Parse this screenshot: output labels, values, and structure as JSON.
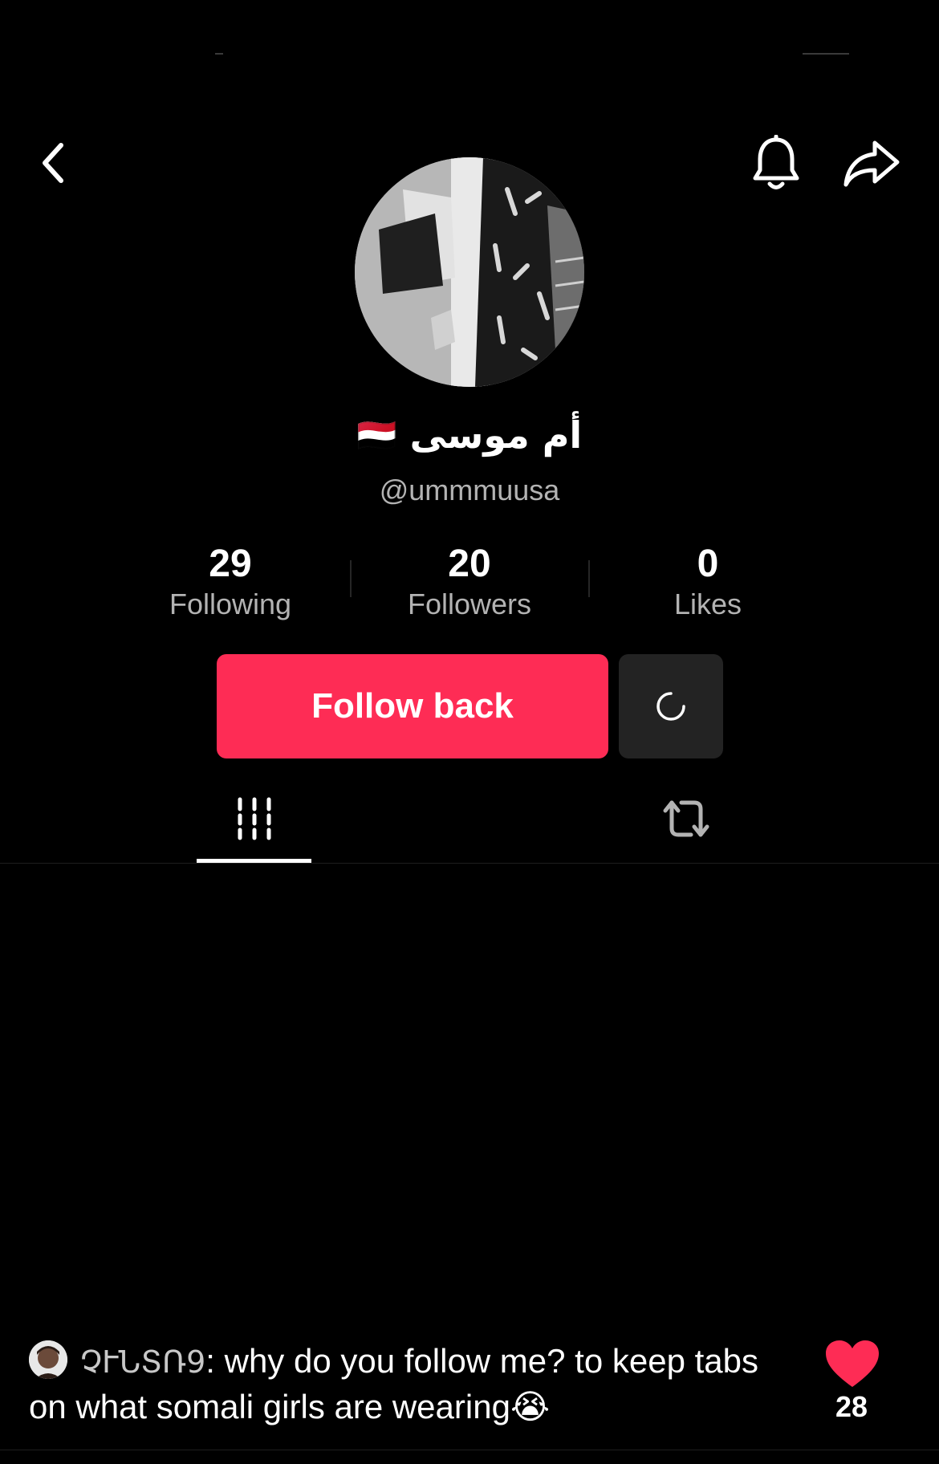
{
  "profile": {
    "display_name": "أم موسى",
    "flag": "🇾🇪",
    "username": "@ummmuusa"
  },
  "stats": [
    {
      "value": "29",
      "label": "Following"
    },
    {
      "value": "20",
      "label": "Followers"
    },
    {
      "value": "0",
      "label": "Likes"
    }
  ],
  "actions": {
    "follow_label": "Follow back"
  },
  "comment": {
    "author": "ʕჩ ͨ ɳ̧ Տ ɳ ɐ9",
    "author_display": "ՉՒՆՏՌ9",
    "text": ": why do you follow me? to keep tabs on what somali girls are wearing",
    "emoji": "😭",
    "like_count": "28"
  },
  "colors": {
    "accent": "#fe2c55",
    "background": "#000000",
    "secondary_text": "#b3b3b3"
  }
}
